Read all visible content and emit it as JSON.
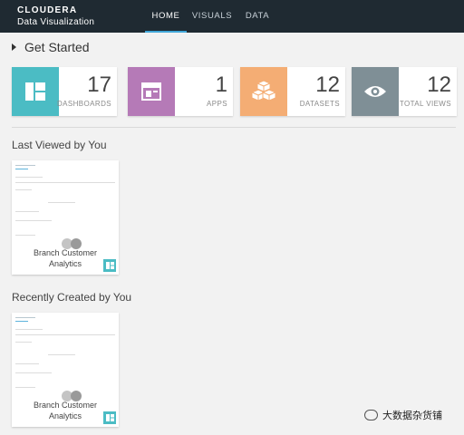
{
  "brand": {
    "name": "CLOUDERA",
    "subtitle": "Data Visualization"
  },
  "nav": {
    "tabs": [
      {
        "label": "HOME",
        "active": true
      },
      {
        "label": "VISUALS"
      },
      {
        "label": "DATA"
      }
    ]
  },
  "get_started": {
    "title": "Get Started"
  },
  "stats": [
    {
      "value": "17",
      "label": "DASHBOARDS",
      "icon": "dashboard-icon",
      "color": "#4bbcc4"
    },
    {
      "value": "1",
      "label": "APPS",
      "icon": "app-icon",
      "color": "#b57ab7"
    },
    {
      "value": "12",
      "label": "DATASETS",
      "icon": "datasets-cubes-icon",
      "color": "#f4ad74"
    },
    {
      "value": "12",
      "label": "TOTAL VIEWS",
      "icon": "eye-icon",
      "color": "#7f8f96"
    }
  ],
  "last_viewed": {
    "title": "Last Viewed by You",
    "cards": [
      {
        "title_line1": "Branch Customer",
        "title_line2": "Analytics"
      }
    ]
  },
  "recently_created": {
    "title": "Recently Created by You",
    "cards": [
      {
        "title_line1": "Branch Customer",
        "title_line2": "Analytics"
      }
    ]
  },
  "watermark": {
    "text": "大数据杂货铺"
  }
}
